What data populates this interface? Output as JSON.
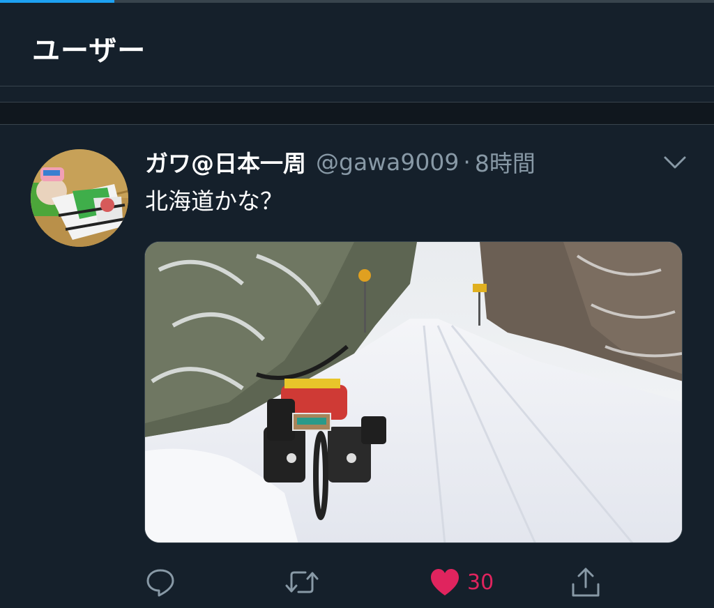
{
  "page": {
    "title": "ユーザー",
    "progress_fraction": 0.16
  },
  "tweet": {
    "display_name": "ガワ@日本一周",
    "handle": "@gawa9009",
    "separator_dot": "·",
    "time_ago": "8時間",
    "text": "北海道かな？",
    "avatar_icon": "user-avatar",
    "menu_icon": "chevron-down-icon",
    "media_alt": "雪道に停められた荷物を積んだ自転車",
    "actions": {
      "reply_icon": "reply-icon",
      "retweet_icon": "retweet-icon",
      "like_icon": "heart-icon",
      "like_count": "30",
      "share_icon": "share-icon"
    }
  },
  "colors": {
    "background": "#15202b",
    "separator_band": "#10171e",
    "border": "#38444d",
    "accent": "#1da1f2",
    "secondary_text": "#8899a6",
    "like": "#e0245e"
  }
}
